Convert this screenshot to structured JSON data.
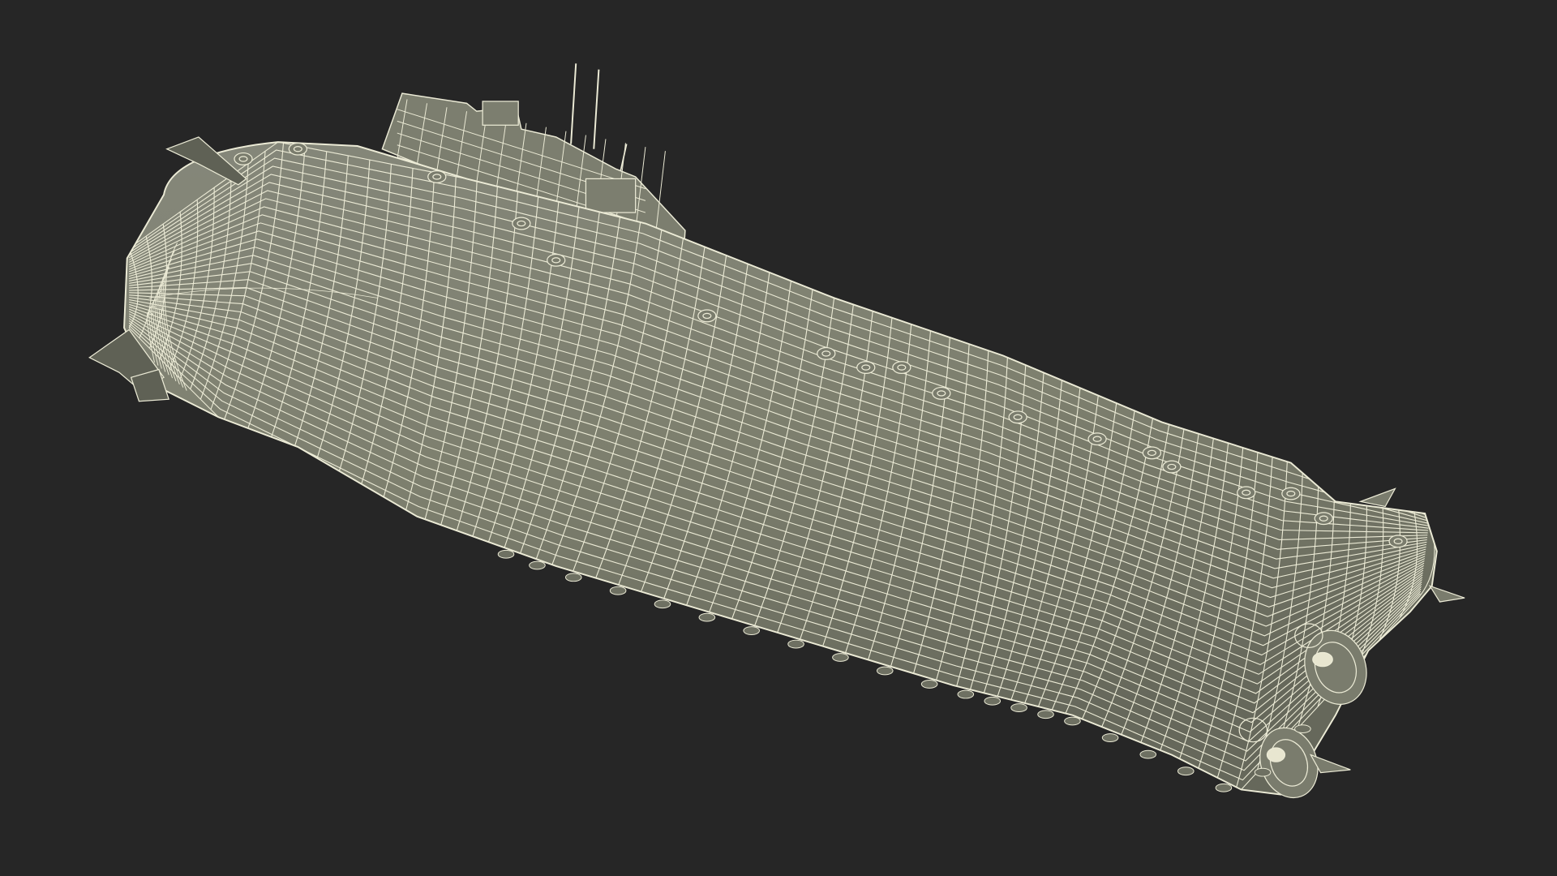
{
  "scene": {
    "background_color": "#262626",
    "hull_fill_color": "#7d7f6e",
    "hull_fill_dark": "#6c6e60",
    "wire_color": "#ecebd6",
    "subject": "submarine-wireframe-render"
  }
}
